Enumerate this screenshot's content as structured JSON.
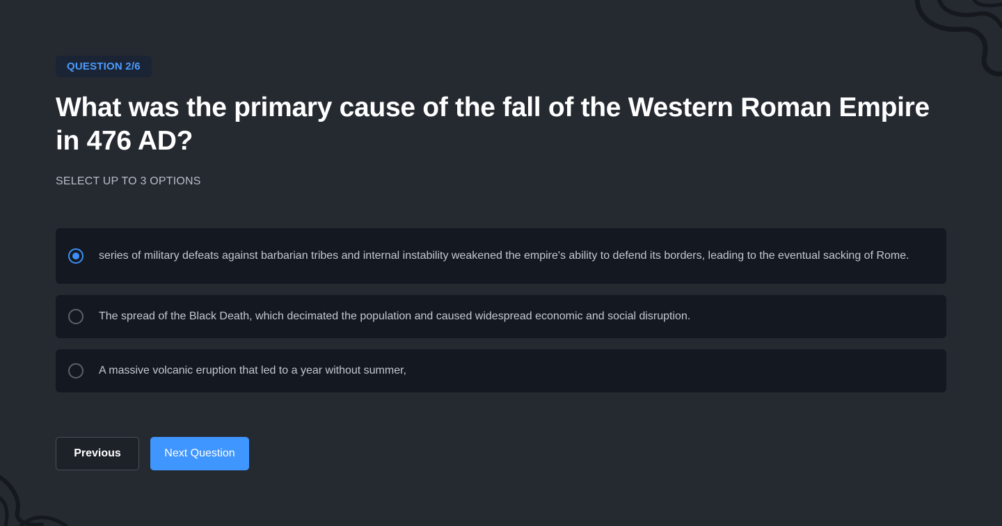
{
  "question": {
    "counter": "QUESTION 2/6",
    "title": "What was the primary cause of the fall of the Western Roman Empire in 476 AD?",
    "hint": "SELECT UP TO 3 OPTIONS"
  },
  "options": [
    {
      "text": "series of military defeats against barbarian tribes and internal instability weakened the empire's ability to defend its borders, leading to the eventual sacking of Rome.",
      "selected": true
    },
    {
      "text": "The spread of the Black Death, which decimated the population and caused widespread economic and social disruption.",
      "selected": false
    },
    {
      "text": "A massive volcanic eruption that led to a year without summer,",
      "selected": false
    }
  ],
  "navigation": {
    "previous_label": "Previous",
    "next_label": "Next Question"
  },
  "colors": {
    "background": "#252a31",
    "option_background": "#141921",
    "accent": "#4096ff",
    "badge_text": "#4b9cff"
  }
}
